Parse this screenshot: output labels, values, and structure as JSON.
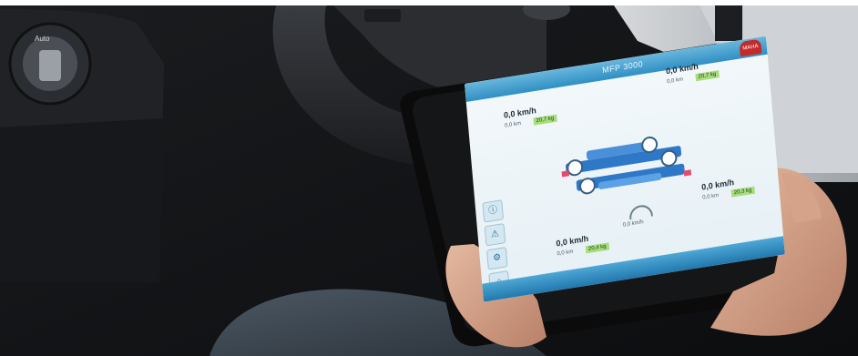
{
  "app": {
    "title": "MFP 3000"
  },
  "panels": [
    {
      "speed": "0,0 km/h",
      "distance": "0,0 km",
      "weight": "20,7 kg"
    },
    {
      "speed": "0,0 km/h",
      "distance": "0,0 km",
      "weight": "20,7 kg"
    },
    {
      "speed": "0,0 km/h",
      "distance": "0,0 km",
      "weight": "20,3 kg"
    },
    {
      "speed": "0,0 km/h",
      "distance": "0,0 km",
      "weight": "20,4 kg"
    }
  ],
  "gauge": {
    "speed": "0,0 km/h"
  },
  "logo": {
    "text": "MAHA"
  },
  "colors": {
    "header_blue": "#2f8fc4",
    "weight_green": "#a7dd7b",
    "logo_red": "#c42a2a"
  }
}
